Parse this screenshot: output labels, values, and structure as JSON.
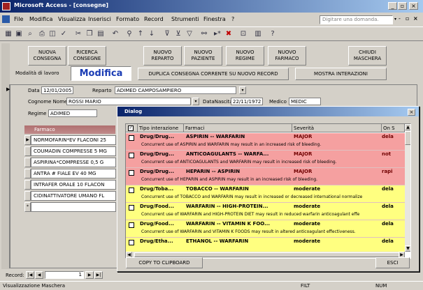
{
  "window": {
    "title": "Microsoft Access - [consegne]"
  },
  "menu": {
    "items": [
      "File",
      "Modifica",
      "Visualizza",
      "Inserisci",
      "Formato",
      "Record",
      "Strumenti",
      "Finestra",
      "?"
    ],
    "ask_placeholder": "Digitare una domanda."
  },
  "header": {
    "buttons": [
      {
        "line1": "NUOVA",
        "line2": "CONSEGNA"
      },
      {
        "line1": "RICERCA",
        "line2": "CONSEGNE"
      },
      {
        "line1": "NUOVO",
        "line2": "REPARTO"
      },
      {
        "line1": "NUOVO",
        "line2": "PAZIENTE"
      },
      {
        "line1": "NUOVO",
        "line2": "REGIME"
      },
      {
        "line1": "NUOVO",
        "line2": "FARMACO"
      },
      {
        "line1": "CHIUDI",
        "line2": "MASCHERA"
      }
    ],
    "mode_label": "Modalità di lavoro",
    "mode_value": "Modifica",
    "duplicate_button": "DUPLICA CONSEGNA CORRENTE SU NUOVO RECORD",
    "show_interactions_button": "MOSTRA INTERAZIONI"
  },
  "form": {
    "data_label": "Data",
    "data_value": "12/01/2005",
    "reparto_label": "Reparto",
    "reparto_value": "ADIMED CAMPOSAMPIERO",
    "cognome_label": "Cognome Nome",
    "cognome_value": "ROSSI MARIO",
    "nascita_label": "DataNascita",
    "nascita_value": "22/11/1972",
    "medico_label": "Medico",
    "medico_value": "MEDIC",
    "regime_label": "Regime",
    "regime_value": "ADIMED"
  },
  "subform": {
    "header": "Farmaco",
    "rows": [
      "NORMOFARIN*EV FLACONI 25",
      "COUMADIN COMPRESSE 5 MG",
      "ASPIRINA*COMPRESSE 0,5 G",
      "ANTRA # FIALE EV 40 MG",
      "INTRAFER ORALE 10 FLACON",
      "CIDINATTIVATORE UMANO FL"
    ]
  },
  "navigation": {
    "record_label": "Record:",
    "record_number": "1",
    "first_icon": "first-record-icon",
    "prev_icon": "prev-record-icon",
    "next_icon": "next-record-icon",
    "last_icon": "last-record-icon"
  },
  "status": {
    "left": "Visualizzazione Maschera",
    "filt": "FILT",
    "num": "NUM"
  },
  "dialog": {
    "title": "Dialog",
    "columns": [
      "Tipo interazione",
      "Farmaci",
      "Severità",
      "On S"
    ],
    "rows": [
      {
        "type": "Drug/Drug...",
        "drugs": "ASPIRIN -- WARFARIN",
        "severity": "MAJOR",
        "onset": "dela",
        "desc": "Concurrent use of ASPIRIN and WARFARIN may result in an increased risk of bleeding.",
        "color": "#f5a0a0",
        "level": "major"
      },
      {
        "type": "Drug/Drug...",
        "drugs": "ANTICOAGULANTS -- WARFA...",
        "severity": "MAJOR",
        "onset": "not",
        "desc": "Concurrent use of ANTICOAGULANTS and WARFARIN may result in increased risk of bleeding.",
        "color": "#f5a0a0",
        "level": "major"
      },
      {
        "type": "Drug/Drug...",
        "drugs": "HEPARIN -- ASPIRIN",
        "severity": "MAJOR",
        "onset": "rapi",
        "desc": "Concurrent use of HEPARIN and ASPIRIN may result in an increased risk of bleeding.",
        "color": "#f5a0a0",
        "level": "major"
      },
      {
        "type": "Drug/Toba...",
        "drugs": "TOBACCO -- WARFARIN",
        "severity": "moderate",
        "onset": "dela",
        "desc": "Concurrent use of TOBACCO and WARFARIN may result in increased or decreased international normalize",
        "color": "#ffff80",
        "level": "moderate"
      },
      {
        "type": "Drug/Food...",
        "drugs": "WARFARIN -- HIGH-PROTEIN...",
        "severity": "moderate",
        "onset": "dela",
        "desc": "Concurrent use of WARFARIN and HIGH-PROTEIN DIET may result in reduced warfarin anticoagulant effe",
        "color": "#ffff80",
        "level": "moderate"
      },
      {
        "type": "Drug/Food...",
        "drugs": "WARFARIN -- VITAMIN K FOO...",
        "severity": "moderate",
        "onset": "dela",
        "desc": "Concurrent use of WARFARIN and VITAMIN K FOODS may result in altered anticoagulant effectiveness.",
        "color": "#ffff80",
        "level": "moderate"
      },
      {
        "type": "Drug/Etha...",
        "drugs": "ETHANOL -- WARFARIN",
        "severity": "moderate",
        "onset": "dela",
        "desc": "",
        "color": "#ffff80",
        "level": "moderate"
      }
    ],
    "copy_button": "COPY TO CLIPBOARD",
    "close_button": "ESCI"
  }
}
